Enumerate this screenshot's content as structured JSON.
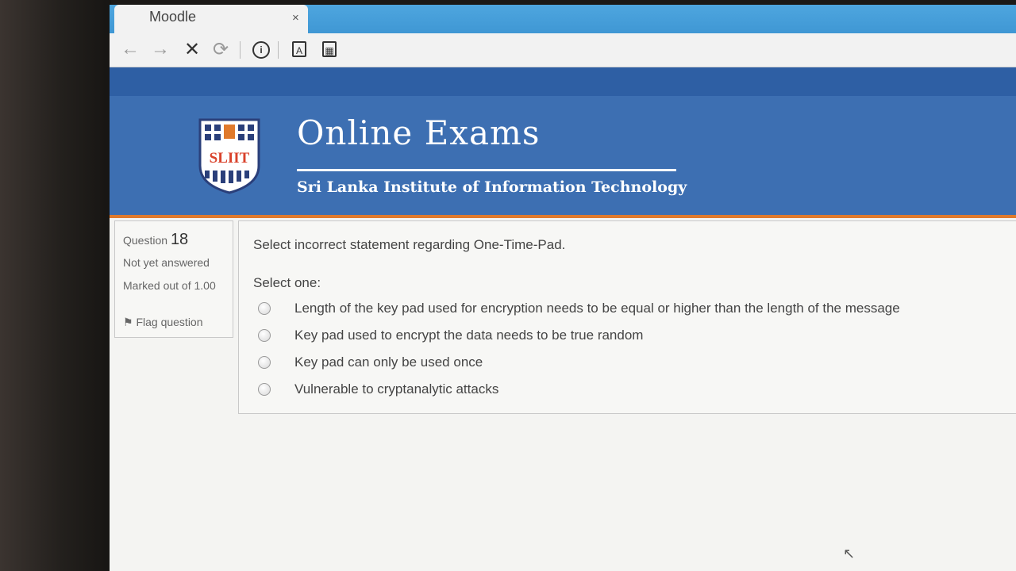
{
  "browser": {
    "tab_title": "Moodle",
    "tab_close": "×",
    "toolbar": {
      "back_icon": "←",
      "forward_icon": "→",
      "stop_icon": "✕",
      "reload_icon": "⟳",
      "info_icon": "i",
      "doc_icon": "A",
      "calc_icon": "▦"
    },
    "accent_color": "#3f97d4"
  },
  "header": {
    "logo_text": "SLIIT",
    "title": "Online Exams",
    "subtitle": "Sri Lanka Institute of Information Technology",
    "banner_color": "#3d6fb2",
    "stripe_color": "#e07a2c"
  },
  "question": {
    "label": "Question",
    "number": "18",
    "state": "Not yet answered",
    "marked_out_of": "Marked out of 1.00",
    "flag_label": "Flag question",
    "text": "Select incorrect statement regarding One-Time-Pad.",
    "prompt": "Select one:",
    "options": [
      "Length of the key pad used for encryption needs to be equal or higher than the length of the message",
      "Key pad used to encrypt the data needs to be true random",
      "Key pad can only be used once",
      "Vulnerable to cryptanalytic attacks"
    ]
  }
}
